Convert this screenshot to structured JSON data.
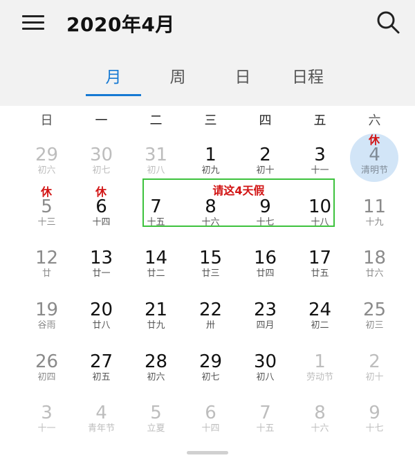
{
  "header": {
    "title": "2020年4月",
    "menu_icon": "hamburger-menu-icon",
    "search_icon": "search-icon"
  },
  "tabs": [
    {
      "label": "月",
      "active": true
    },
    {
      "label": "周",
      "active": false
    },
    {
      "label": "日",
      "active": false
    },
    {
      "label": "日程",
      "active": false
    }
  ],
  "weekdays": [
    "日",
    "一",
    "二",
    "三",
    "四",
    "五",
    "六"
  ],
  "weeks": [
    [
      {
        "day": "29",
        "lunar": "初六",
        "muted": true
      },
      {
        "day": "30",
        "lunar": "初七",
        "muted": true
      },
      {
        "day": "31",
        "lunar": "初八",
        "muted": true
      },
      {
        "day": "1",
        "lunar": "初九"
      },
      {
        "day": "2",
        "lunar": "初十"
      },
      {
        "day": "3",
        "lunar": "十一"
      },
      {
        "day": "4",
        "lunar": "清明节",
        "today": true,
        "badge": "休"
      }
    ],
    [
      {
        "day": "5",
        "lunar": "十三",
        "badge": "休"
      },
      {
        "day": "6",
        "lunar": "十四",
        "badge": "休"
      },
      {
        "day": "7",
        "lunar": "十五"
      },
      {
        "day": "8",
        "lunar": "十六"
      },
      {
        "day": "9",
        "lunar": "十七"
      },
      {
        "day": "10",
        "lunar": "十八"
      },
      {
        "day": "11",
        "lunar": "十九"
      }
    ],
    [
      {
        "day": "12",
        "lunar": "廿"
      },
      {
        "day": "13",
        "lunar": "廿一"
      },
      {
        "day": "14",
        "lunar": "廿二"
      },
      {
        "day": "15",
        "lunar": "廿三"
      },
      {
        "day": "16",
        "lunar": "廿四"
      },
      {
        "day": "17",
        "lunar": "廿五"
      },
      {
        "day": "18",
        "lunar": "廿六"
      }
    ],
    [
      {
        "day": "19",
        "lunar": "谷雨"
      },
      {
        "day": "20",
        "lunar": "廿八"
      },
      {
        "day": "21",
        "lunar": "廿九"
      },
      {
        "day": "22",
        "lunar": "卅"
      },
      {
        "day": "23",
        "lunar": "四月"
      },
      {
        "day": "24",
        "lunar": "初二"
      },
      {
        "day": "25",
        "lunar": "初三"
      }
    ],
    [
      {
        "day": "26",
        "lunar": "初四"
      },
      {
        "day": "27",
        "lunar": "初五"
      },
      {
        "day": "28",
        "lunar": "初六"
      },
      {
        "day": "29",
        "lunar": "初七"
      },
      {
        "day": "30",
        "lunar": "初八"
      },
      {
        "day": "1",
        "lunar": "劳动节",
        "muted": true
      },
      {
        "day": "2",
        "lunar": "初十",
        "muted": true
      }
    ],
    [
      {
        "day": "3",
        "lunar": "十一",
        "muted": true
      },
      {
        "day": "4",
        "lunar": "青年节",
        "muted": true
      },
      {
        "day": "5",
        "lunar": "立夏",
        "muted": true
      },
      {
        "day": "6",
        "lunar": "十四",
        "muted": true
      },
      {
        "day": "7",
        "lunar": "十五",
        "muted": true
      },
      {
        "day": "8",
        "lunar": "十六",
        "muted": true
      },
      {
        "day": "9",
        "lunar": "十七",
        "muted": true
      }
    ]
  ],
  "annotation": {
    "text": "请这4天假",
    "box_color": "#3cc23c",
    "text_color": "#d21414"
  },
  "colors": {
    "accent": "#1679d3",
    "rest_badge": "#d21414",
    "today_circle": "#d2e5f7"
  }
}
